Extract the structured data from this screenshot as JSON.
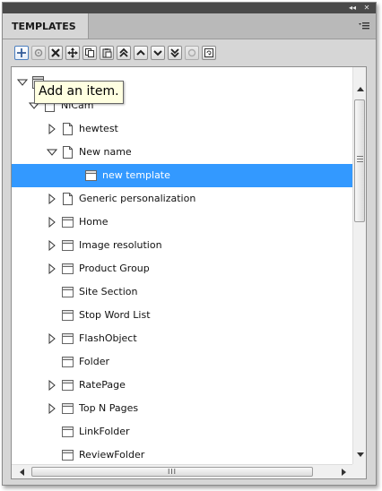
{
  "panel": {
    "title_buttons": [
      {
        "name": "collapse-icon",
        "glyph": "◂◂"
      },
      {
        "name": "close-icon",
        "glyph": "✕"
      }
    ],
    "tab_label": "TEMPLATES",
    "menu_icon": "panel-menu-icon"
  },
  "toolbar": {
    "buttons": [
      {
        "name": "add-item-button",
        "icon": "plus-icon",
        "state": "active"
      },
      {
        "name": "add-child-button",
        "icon": "gear-icon",
        "state": "disabled"
      },
      {
        "name": "delete-button",
        "icon": "delete-icon",
        "state": "normal"
      },
      {
        "name": "move-button",
        "icon": "move-icon",
        "state": "normal"
      },
      {
        "name": "copy-button",
        "icon": "copy-icon",
        "state": "normal"
      },
      {
        "name": "paste-button",
        "icon": "paste-icon",
        "state": "normal"
      },
      {
        "name": "move-top-button",
        "icon": "double-up-icon",
        "state": "normal"
      },
      {
        "name": "move-up-button",
        "icon": "up-icon",
        "state": "normal"
      },
      {
        "name": "move-down-button",
        "icon": "down-icon",
        "state": "normal"
      },
      {
        "name": "move-bottom-button",
        "icon": "double-down-icon",
        "state": "normal"
      },
      {
        "name": "disabled-action-button",
        "icon": "circle-icon",
        "state": "disabled"
      },
      {
        "name": "refresh-button",
        "icon": "refresh-icon",
        "state": "normal"
      }
    ]
  },
  "tree": {
    "rows": [
      {
        "label": "",
        "depth": 0,
        "expander": "expanded",
        "icon": "folder-icon",
        "selected": false
      },
      {
        "label": "NiCam",
        "depth": 1,
        "expander": "expanded",
        "icon": "page-icon",
        "selected": false
      },
      {
        "label": "hewtest",
        "depth": 2,
        "expander": "collapsed",
        "icon": "page-icon",
        "selected": false
      },
      {
        "label": "New name",
        "depth": 2,
        "expander": "expanded",
        "icon": "page-icon",
        "selected": false
      },
      {
        "label": "new template",
        "depth": 3,
        "expander": "none",
        "icon": "template-icon",
        "selected": true
      },
      {
        "label": "Generic personalization",
        "depth": 2,
        "expander": "collapsed",
        "icon": "page-icon",
        "selected": false
      },
      {
        "label": "Home",
        "depth": 2,
        "expander": "collapsed",
        "icon": "template-icon",
        "selected": false
      },
      {
        "label": "Image resolution",
        "depth": 2,
        "expander": "collapsed",
        "icon": "template-icon",
        "selected": false
      },
      {
        "label": "Product Group",
        "depth": 2,
        "expander": "collapsed",
        "icon": "template-icon",
        "selected": false
      },
      {
        "label": "Site Section",
        "depth": 2,
        "expander": "none",
        "icon": "template-icon",
        "selected": false
      },
      {
        "label": "Stop Word List",
        "depth": 2,
        "expander": "none",
        "icon": "template-icon",
        "selected": false
      },
      {
        "label": "FlashObject",
        "depth": 2,
        "expander": "collapsed",
        "icon": "template-icon",
        "selected": false
      },
      {
        "label": "Folder",
        "depth": 2,
        "expander": "none",
        "icon": "template-icon",
        "selected": false
      },
      {
        "label": "RatePage",
        "depth": 2,
        "expander": "collapsed",
        "icon": "template-icon",
        "selected": false
      },
      {
        "label": "Top N Pages",
        "depth": 2,
        "expander": "collapsed",
        "icon": "template-icon",
        "selected": false
      },
      {
        "label": "LinkFolder",
        "depth": 2,
        "expander": "none",
        "icon": "template-icon",
        "selected": false
      },
      {
        "label": "ReviewFolder",
        "depth": 2,
        "expander": "none",
        "icon": "template-icon",
        "selected": false
      }
    ]
  },
  "scrollbar": {
    "hthumb_glyph": "III",
    "vertical_position_fraction": 0.0
  },
  "tooltip": {
    "text": "Add an item."
  },
  "colors": {
    "selection": "#3399ff",
    "panel_bg": "#d6d6d6",
    "titlebar": "#4a4a4a",
    "tooltip_bg": "#ffffe1"
  }
}
